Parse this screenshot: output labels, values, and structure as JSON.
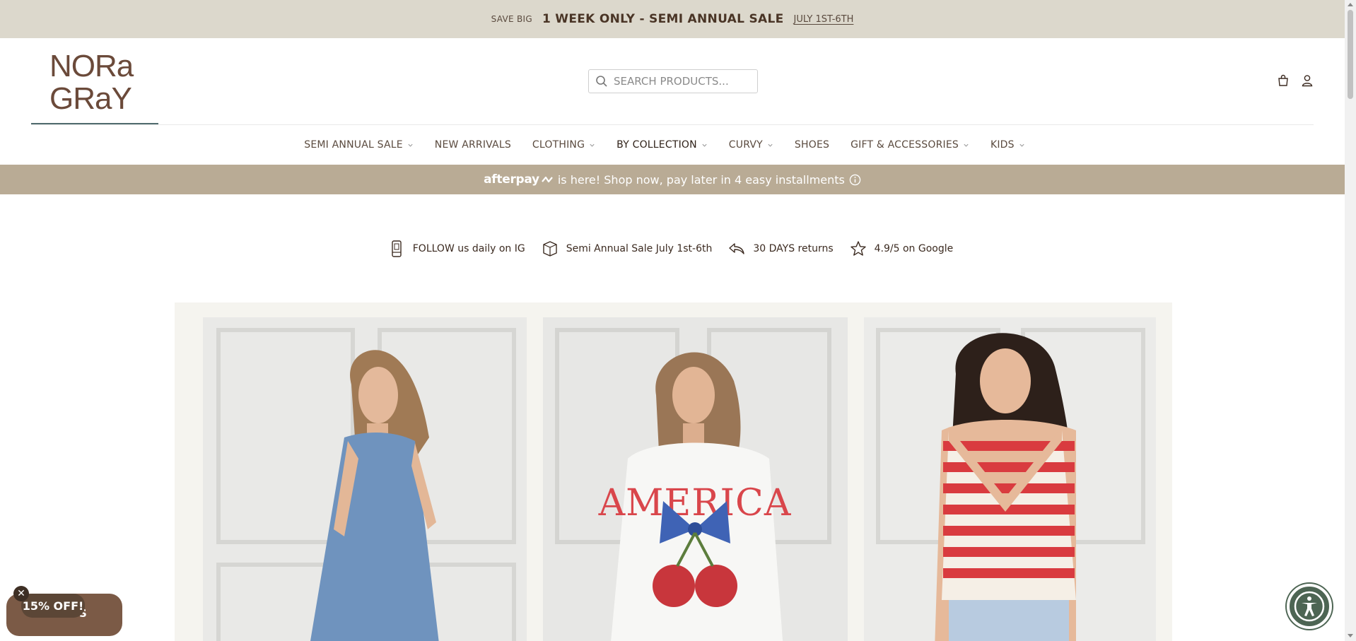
{
  "announcement": {
    "lead": "SAVE BIG",
    "headline": "1 WEEK ONLY - SEMI ANNUAL SALE",
    "link": "JULY 1ST-6TH"
  },
  "brand": {
    "line1": "NORa",
    "line2": "GRaY"
  },
  "search": {
    "placeholder": "SEARCH PRODUCTS..."
  },
  "header_icons": [
    "cart-icon",
    "account-icon"
  ],
  "nav": {
    "items": [
      {
        "label": "SEMI ANNUAL SALE",
        "dropdown": true
      },
      {
        "label": "NEW ARRIVALS",
        "dropdown": false
      },
      {
        "label": "CLOTHING",
        "dropdown": true
      },
      {
        "label": "BY COLLECTION",
        "dropdown": true
      },
      {
        "label": "CURVY",
        "dropdown": true
      },
      {
        "label": "SHOES",
        "dropdown": false
      },
      {
        "label": "GIFT & ACCESSORIES",
        "dropdown": true
      },
      {
        "label": "KIDS",
        "dropdown": true
      }
    ]
  },
  "afterpay": {
    "brand": "afterpay",
    "message": "is here! Shop now, pay later in 4 easy installments",
    "info_icon": "info-icon"
  },
  "usps": [
    {
      "icon": "phone-icon",
      "text": "FOLLOW us daily on IG"
    },
    {
      "icon": "box-icon",
      "text": "Semi Annual Sale July 1st-6th"
    },
    {
      "icon": "return-arrow-icon",
      "text": "30 DAYS returns"
    },
    {
      "icon": "star-icon",
      "text": "4.9/5 on Google"
    }
  ],
  "gallery": {
    "cards": [
      {
        "alt": "Denim sleeveless dress"
      },
      {
        "alt": "AMERICA cherry bow sweatshirt",
        "print_text": "AMERICA"
      },
      {
        "alt": "Red and white striped sweater vest"
      }
    ]
  },
  "promo": {
    "label": "15% OFF!",
    "behind": "S",
    "close": "✕"
  },
  "colors": {
    "announce_bg": "#dcd8cc",
    "afterpay_bg": "#b9ab95",
    "brand_brown": "#6b4a3a",
    "accent_teal": "#4f6b6e",
    "a11y_green": "#4d6553"
  }
}
